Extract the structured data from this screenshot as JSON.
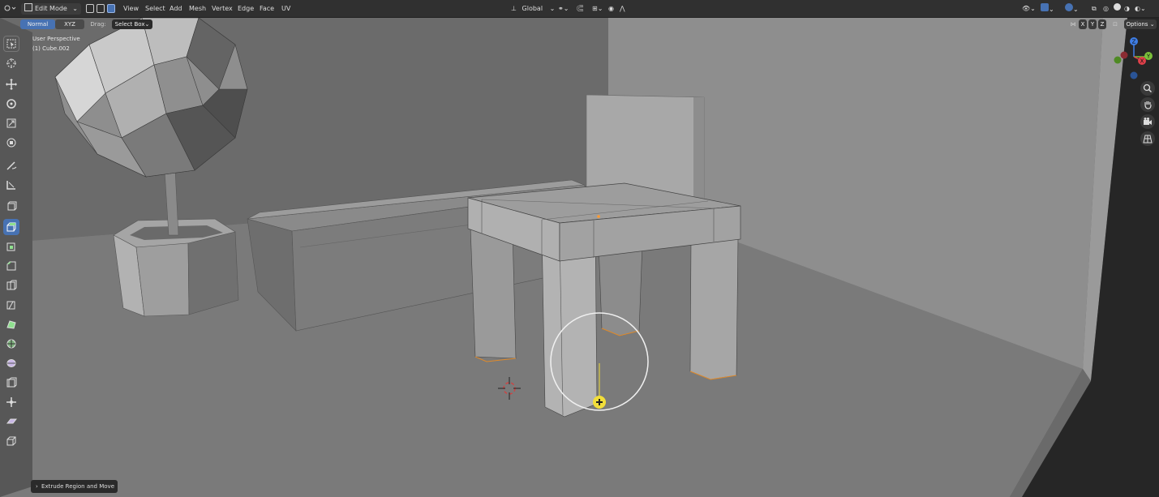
{
  "header": {
    "mode": "Edit Mode",
    "menus": [
      "View",
      "Select",
      "Add",
      "Mesh",
      "Vertex",
      "Edge",
      "Face",
      "UV"
    ],
    "orientation": "Global",
    "options_label": "Options"
  },
  "tool_header": {
    "orientation_normal": "Normal",
    "orientation_xyz": "XYZ",
    "drag_label": "Drag:",
    "drag_value": "Select Box",
    "axis_x": "X",
    "axis_y": "Y",
    "axis_z": "Z"
  },
  "viewport": {
    "perspective": "User Perspective",
    "object": "(1) Cube.002"
  },
  "gizmo": {
    "x": "X",
    "y": "Y",
    "z": "Z"
  },
  "last_operator": "Extrude Region and Move",
  "colors": {
    "accent": "#4772b3",
    "gizmo_x": "#e0404a",
    "gizmo_y": "#7bbf3a",
    "gizmo_z": "#3f7ee6",
    "selected_vertex": "#ff9a30",
    "cursor_yellow": "#f2de3a"
  },
  "toolbar_icons": [
    "select-box-icon",
    "cursor-icon",
    "move-icon",
    "rotate-icon",
    "scale-icon",
    "transform-icon",
    "annotate-icon",
    "measure-icon",
    "add-cube-icon",
    "extrude-region-icon",
    "inset-faces-icon",
    "bevel-icon",
    "loop-cut-icon",
    "knife-icon",
    "poly-build-icon",
    "spin-icon",
    "smooth-icon",
    "edge-slide-icon",
    "shrink-fatten-icon",
    "shear-icon",
    "rip-region-icon"
  ]
}
